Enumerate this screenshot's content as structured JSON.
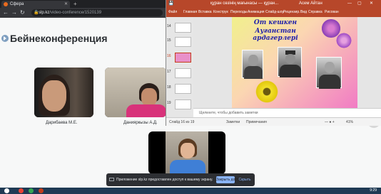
{
  "browser": {
    "tab_title": "Сфера",
    "url_domain": "slp.kz",
    "url_path": "/video-conference/1520139"
  },
  "conference": {
    "title": "Бейнеконференция",
    "participants": [
      {
        "name": "Дарибаева М.Е."
      },
      {
        "name": "Данияркызы А.Д."
      }
    ]
  },
  "ppt": {
    "title_doc": "құран сөзінің мағынасы — құран...",
    "title_user": "Асем Айтан",
    "ribbon_tabs": [
      "Файл",
      "Главная",
      "Вставка",
      "Конструк",
      "Переходы",
      "Анимация",
      "Слайд-шоу",
      "Рецензир.",
      "Вид",
      "Справка",
      "Рисован"
    ],
    "slides": [
      {
        "num": "14"
      },
      {
        "num": "15"
      },
      {
        "num": "16"
      },
      {
        "num": "17"
      },
      {
        "num": "18"
      },
      {
        "num": "19"
      }
    ],
    "active_slide": "16",
    "slide_title_1": "От кешкен",
    "slide_title_2": "Ауғанстан ардагерлері",
    "notes_placeholder": "Щелкните, чтобы добавить заметки",
    "status_slide": "Слайд 16 из 19",
    "status_notes": "Заметки",
    "status_comments": "Примечания",
    "status_zoom": "41%"
  },
  "share": {
    "message": "Приложение slp.kz предоставлен доступ к вашему экрану.",
    "stop_label": "Закрыть доступ",
    "hide_label": "Скрыть"
  },
  "taskbar": {
    "time": "9:29"
  }
}
